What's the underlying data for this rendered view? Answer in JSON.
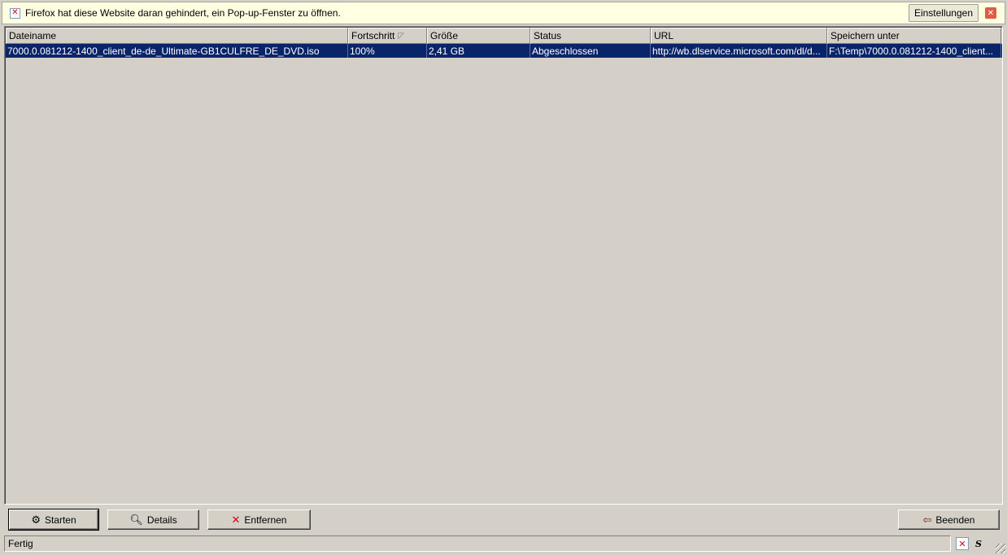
{
  "notification": {
    "text": "Firefox hat diese Website daran gehindert, ein Pop-up-Fenster zu öffnen.",
    "settings_label": "Einstellungen"
  },
  "columns": [
    "Dateiname",
    "Fortschritt",
    "Größe",
    "Status",
    "URL",
    "Speichern unter"
  ],
  "rows": [
    {
      "filename": "7000.0.081212-1400_client_de-de_Ultimate-GB1CULFRE_DE_DVD.iso",
      "progress": "100%",
      "size": "2,41 GB",
      "status": "Abgeschlossen",
      "url": "http://wb.dlservice.microsoft.com/dl/d...",
      "save_to": "F:\\Temp\\7000.0.081212-1400_client..."
    }
  ],
  "buttons": {
    "start": "Starten",
    "details": "Details",
    "remove": "Entfernen",
    "quit": "Beenden"
  },
  "statusbar": {
    "text": "Fertig"
  },
  "colors": {
    "selection": "#0a246a",
    "window_bg": "#d4d0c8",
    "notification_bg": "#ffffe1"
  }
}
